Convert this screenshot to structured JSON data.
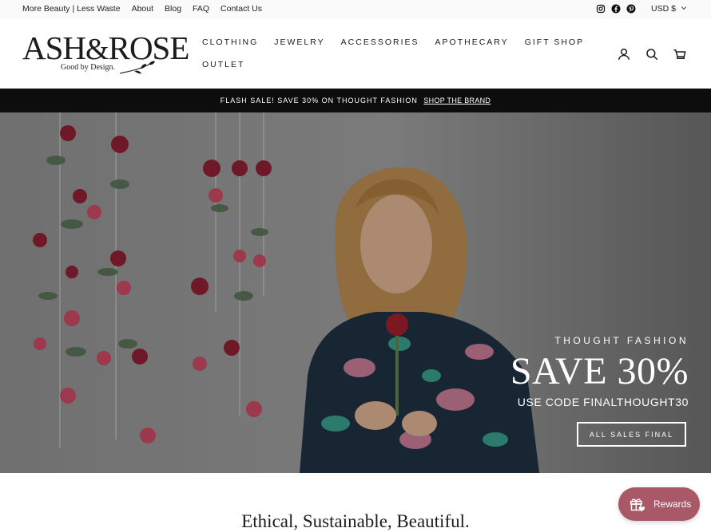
{
  "utility": {
    "links": [
      "More Beauty | Less Waste",
      "About",
      "Blog",
      "FAQ",
      "Contact Us"
    ],
    "social_icons": [
      "instagram-icon",
      "facebook-icon",
      "pinterest-icon"
    ],
    "currency": "USD $"
  },
  "header": {
    "logo": {
      "main": "ASH",
      "amp": "&",
      "rest": "ROSE",
      "tagline": "Good by Design."
    },
    "nav": {
      "row1": [
        "CLOTHING",
        "JEWELRY",
        "ACCESSORIES",
        "APOTHECARY",
        "GIFT SHOP"
      ],
      "row2": [
        "OUTLET"
      ]
    },
    "icons": [
      "account-icon",
      "search-icon",
      "cart-icon"
    ]
  },
  "announcement": {
    "text": "FLASH SALE! SAVE 30% ON THOUGHT FASHION",
    "link": "SHOP THE BRAND"
  },
  "hero": {
    "kicker": "THOUGHT FASHION",
    "title": "SAVE 30%",
    "code": "USE CODE FINALTHOUGHT30",
    "button": "ALL SALES FINAL"
  },
  "section": {
    "tagline": "Ethical, Sustainable, Beautiful."
  },
  "rewards": {
    "label": "Rewards"
  },
  "colors": {
    "announce_bg": "#0d0d0d",
    "rewards_bg": "#a85866",
    "hero_overlay": "#6f6f6f"
  }
}
